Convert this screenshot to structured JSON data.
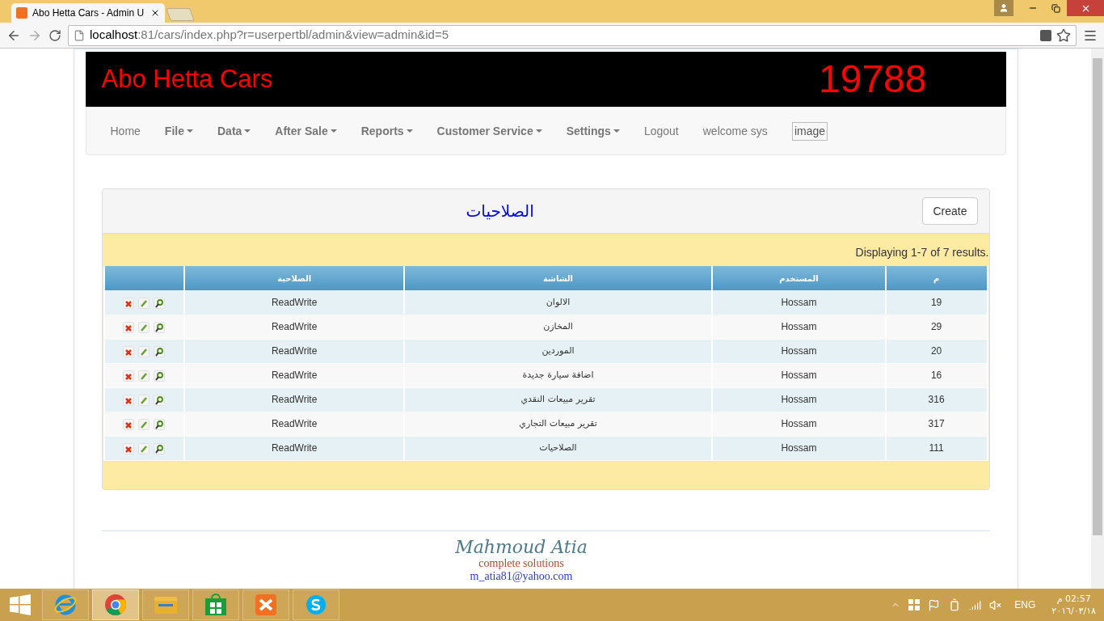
{
  "browser": {
    "tab_title": "Abo Hetta Cars - Admin U",
    "url_host": "localhost",
    "url_rest": ":81/cars/index.php?r=userpertbl/admin&view=admin&id=5"
  },
  "header": {
    "brand": "Abo Hetta Cars",
    "number": "19788"
  },
  "nav": [
    {
      "label": "Home",
      "kind": "link"
    },
    {
      "label": "File",
      "kind": "dropdown"
    },
    {
      "label": "Data",
      "kind": "dropdown"
    },
    {
      "label": "After Sale",
      "kind": "dropdown"
    },
    {
      "label": "Reports",
      "kind": "dropdown"
    },
    {
      "label": "Customer Service",
      "kind": "dropdown"
    },
    {
      "label": "Settings",
      "kind": "dropdown"
    },
    {
      "label": "Logout",
      "kind": "link"
    },
    {
      "label": "welcome sys",
      "kind": "text"
    },
    {
      "label": "image",
      "kind": "image"
    }
  ],
  "panel": {
    "title": "الصلاحيات",
    "create_button": "Create",
    "summary": "Displaying 1-7 of 7 results."
  },
  "table": {
    "columns": [
      "الصلاحية",
      "الشاشة",
      "المستخدم",
      "م"
    ],
    "rows": [
      {
        "cells": [
          "ReadWrite",
          "الالوان",
          "Hossam",
          "19"
        ]
      },
      {
        "cells": [
          "ReadWrite",
          "المخازن",
          "Hossam",
          "29"
        ]
      },
      {
        "cells": [
          "ReadWrite",
          "الموردين",
          "Hossam",
          "20"
        ]
      },
      {
        "cells": [
          "ReadWrite",
          "اضافة سيارة جديدة",
          "Hossam",
          "16"
        ]
      },
      {
        "cells": [
          "ReadWrite",
          "تقرير مبيعات النقدي",
          "Hossam",
          "316"
        ]
      },
      {
        "cells": [
          "ReadWrite",
          "تقرير مبيعات التجاري",
          "Hossam",
          "317"
        ]
      },
      {
        "cells": [
          "ReadWrite",
          "الصلاحيات",
          "Hossam",
          "111"
        ]
      }
    ]
  },
  "footer": {
    "signature": "Mahmoud Atia",
    "tagline": "complete solutions",
    "email": "m_atia81@yahoo.com"
  },
  "taskbar": {
    "apps": [
      {
        "kind": "ie",
        "selected": false
      },
      {
        "kind": "chrome",
        "selected": true
      },
      {
        "kind": "explorer",
        "selected": false
      },
      {
        "kind": "store",
        "selected": false
      },
      {
        "kind": "xampp",
        "selected": false
      },
      {
        "kind": "skype",
        "selected": false
      }
    ],
    "language": "ENG",
    "time": "02:57 م",
    "date": "٢٠١٦/٠٣/١٨"
  }
}
